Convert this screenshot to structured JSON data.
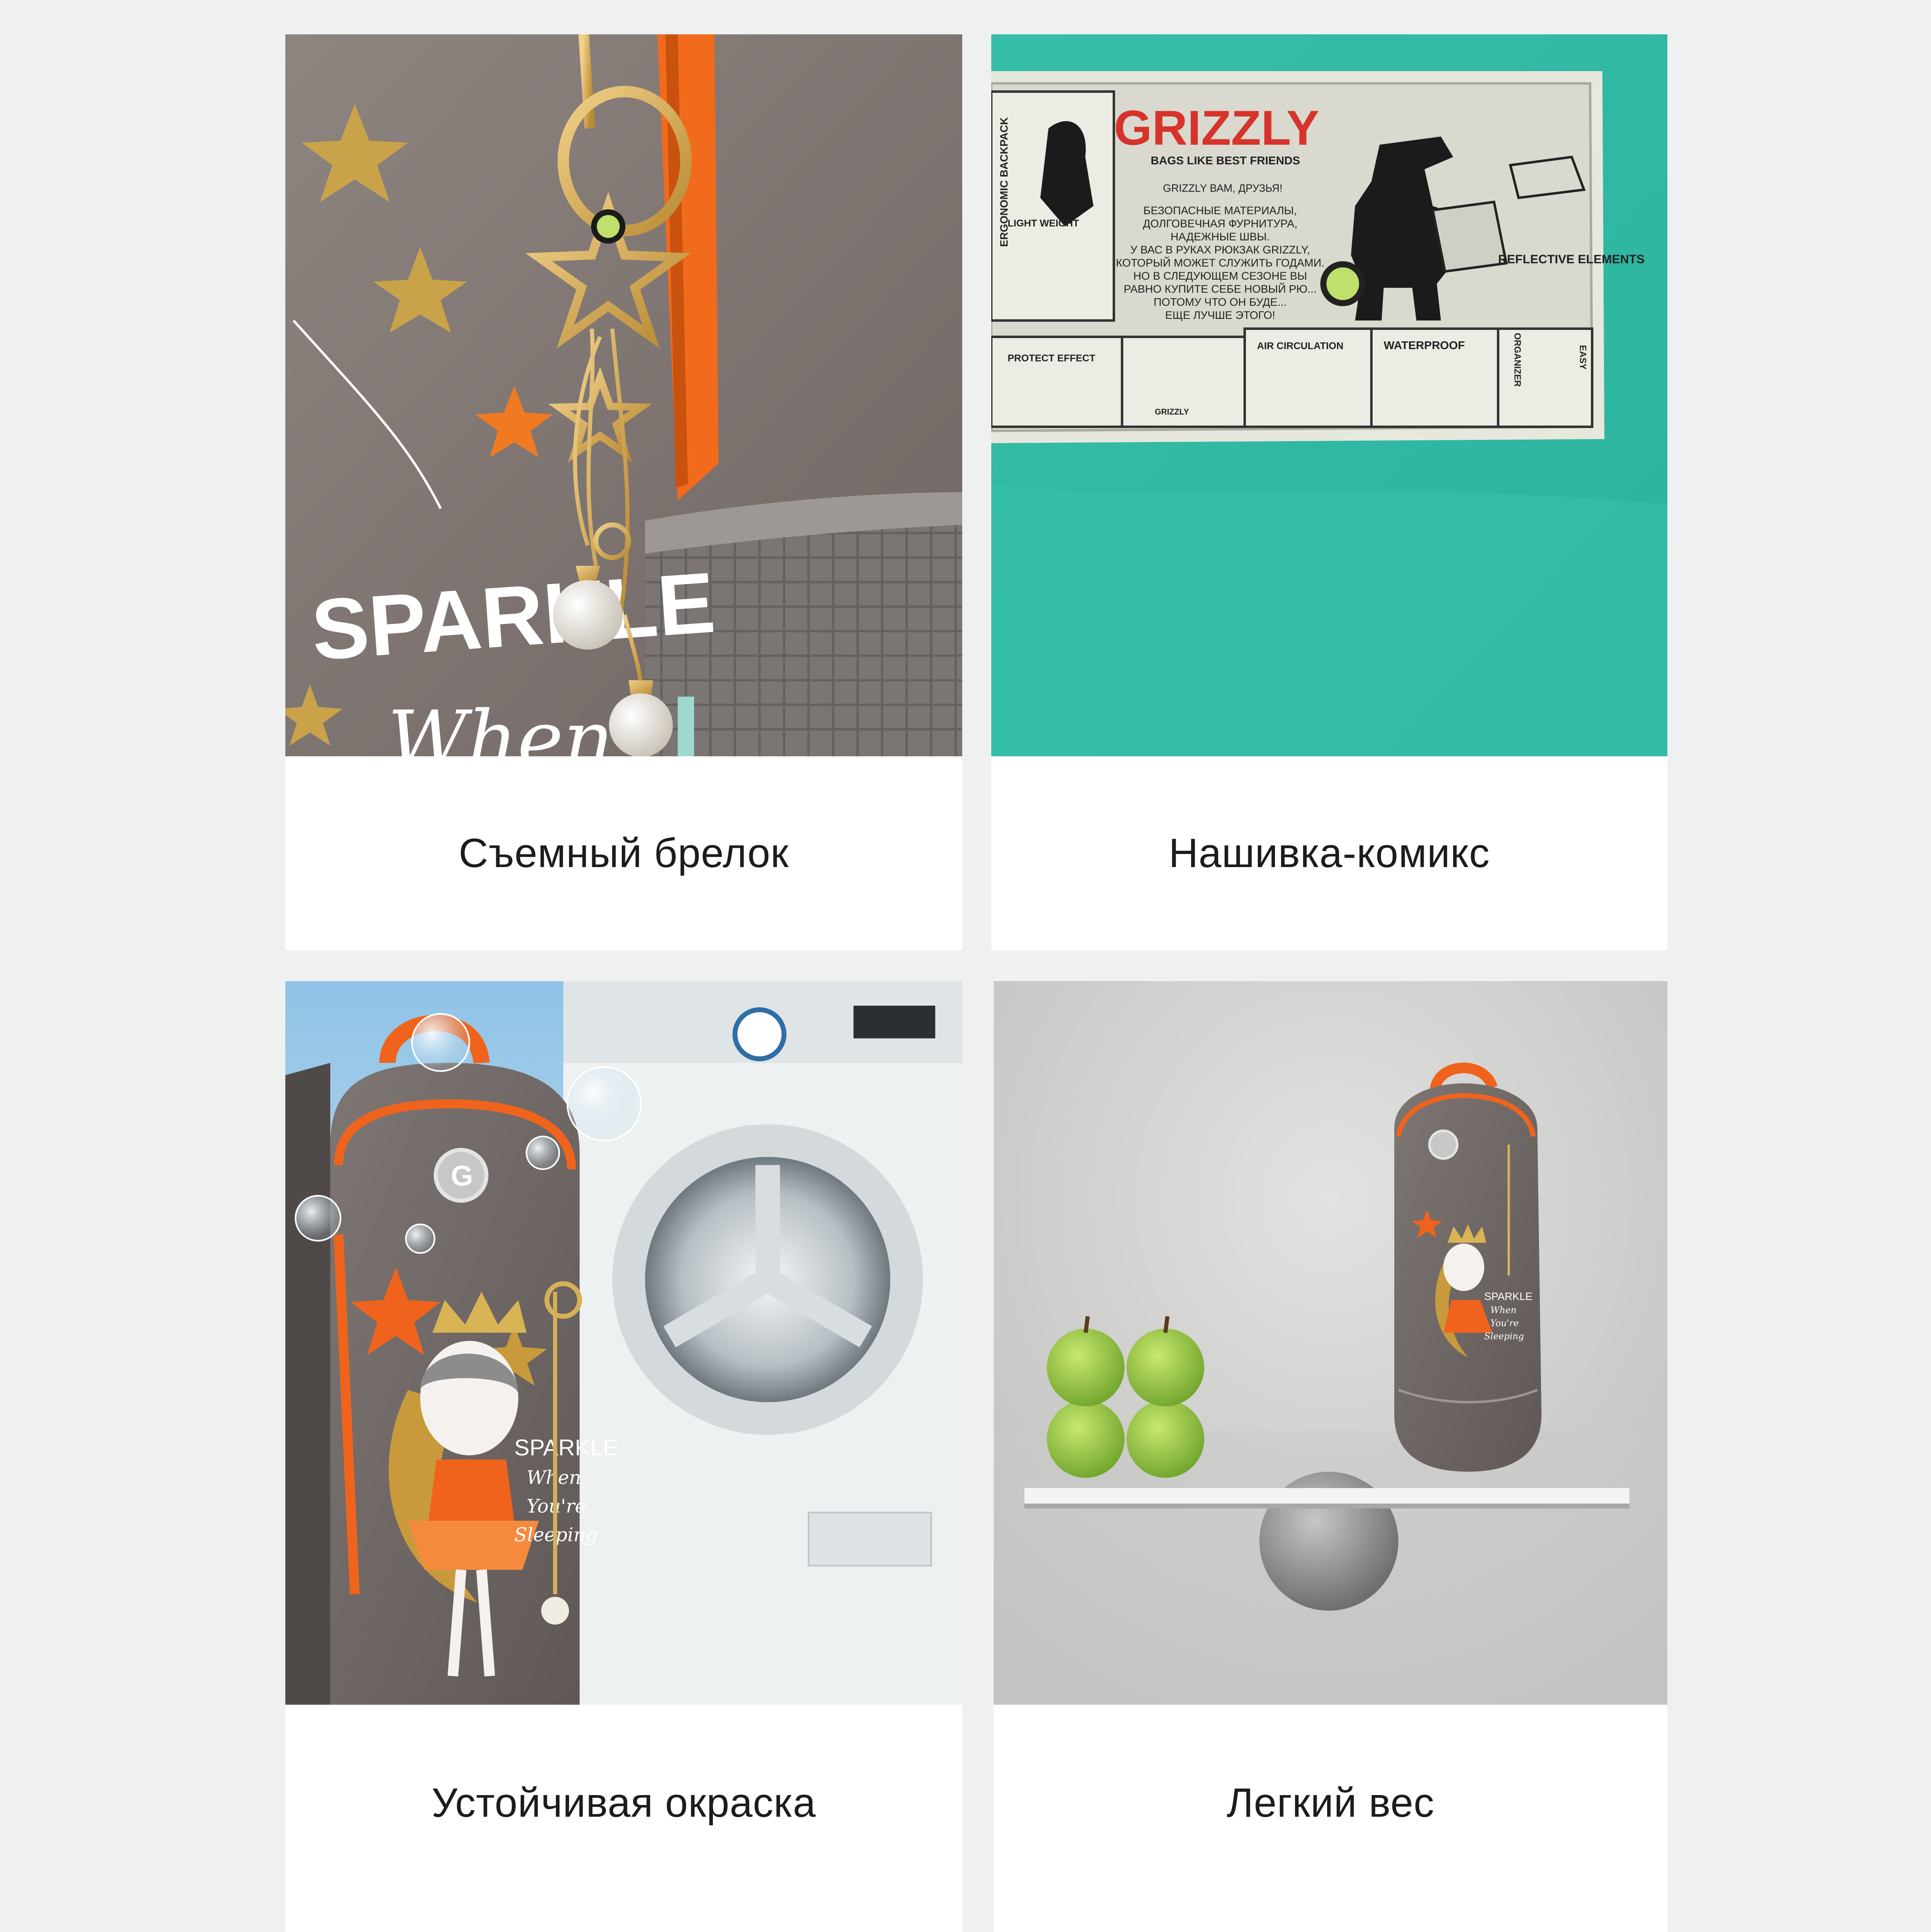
{
  "cards": [
    {
      "caption": "Съемный брелок",
      "photo": {
        "print_line1": "SPARKLE",
        "print_line2": "When",
        "colors": {
          "fabric": "#8a7f7c",
          "zipper": "#f26a1b",
          "gold": "#c9a24a",
          "star_orange": "#f07a22"
        }
      }
    },
    {
      "caption": "Нашивка-комикс",
      "photo": {
        "brand": "GRIZZLY",
        "tagline": "BAGS LIKE BEST FRIENDS",
        "greeting": "GRIZZLY ВАМ, ДРУЗЬЯ!",
        "body_lines": [
          "БЕЗОПАСНЫЕ МАТЕРИАЛЫ,",
          "ДОЛГОВЕЧНАЯ ФУРНИТУРА,",
          "НАДЕЖНЫЕ ШВЫ.",
          "У ВАС В РУКАХ РЮКЗАК GRIZZLY,",
          "КОТОРЫЙ МОЖЕТ СЛУЖИТЬ ГОДАМИ.",
          "НО В СЛЕДУЮЩЕМ СЕЗОНЕ ВЫ",
          "РАВНО КУПИТЕ СЕБЕ НОВЫЙ РЮ...",
          "ПОТОМУ ЧТО ОН БУДЕ...",
          "ЕЩЕ ЛУЧШЕ ЭТОГО!"
        ],
        "labels": {
          "ergonomic": "ERGONOMIC BACKPACK",
          "light_weight": "LIGHT WEIGHT",
          "reflective": "REFLECTIVE ELEMENTS",
          "protect": "PROTECT EFFECT",
          "air": "AIR CIRCULATION",
          "waterproof": "WATERPROOF",
          "organizer": "ORGANIZER",
          "easy": "EASY",
          "small_brand": "GRIZZLY"
        },
        "colors": {
          "background": "#3fc2ad",
          "patch": "#dcdcd2",
          "red": "#d7332b"
        }
      }
    },
    {
      "caption": "Устойчивая окраска",
      "photo": {
        "print_line1": "SPARKLE",
        "print_line2": "When",
        "print_line3": "You're",
        "print_line4": "Sleeping",
        "colors": {
          "backpack": "#77706d",
          "orange": "#f0631c",
          "gold": "#c89a3c"
        }
      }
    },
    {
      "caption": "Легкий вес",
      "photo": {
        "print_line1": "SPARKLE",
        "print_line2": "When",
        "print_line3": "You're",
        "print_line4": "Sleeping",
        "colors": {
          "background": "#d2d2d0",
          "apple": "#8cc63f",
          "board": "#f2f2f2",
          "sphere": "#8f8f8f"
        }
      }
    }
  ]
}
